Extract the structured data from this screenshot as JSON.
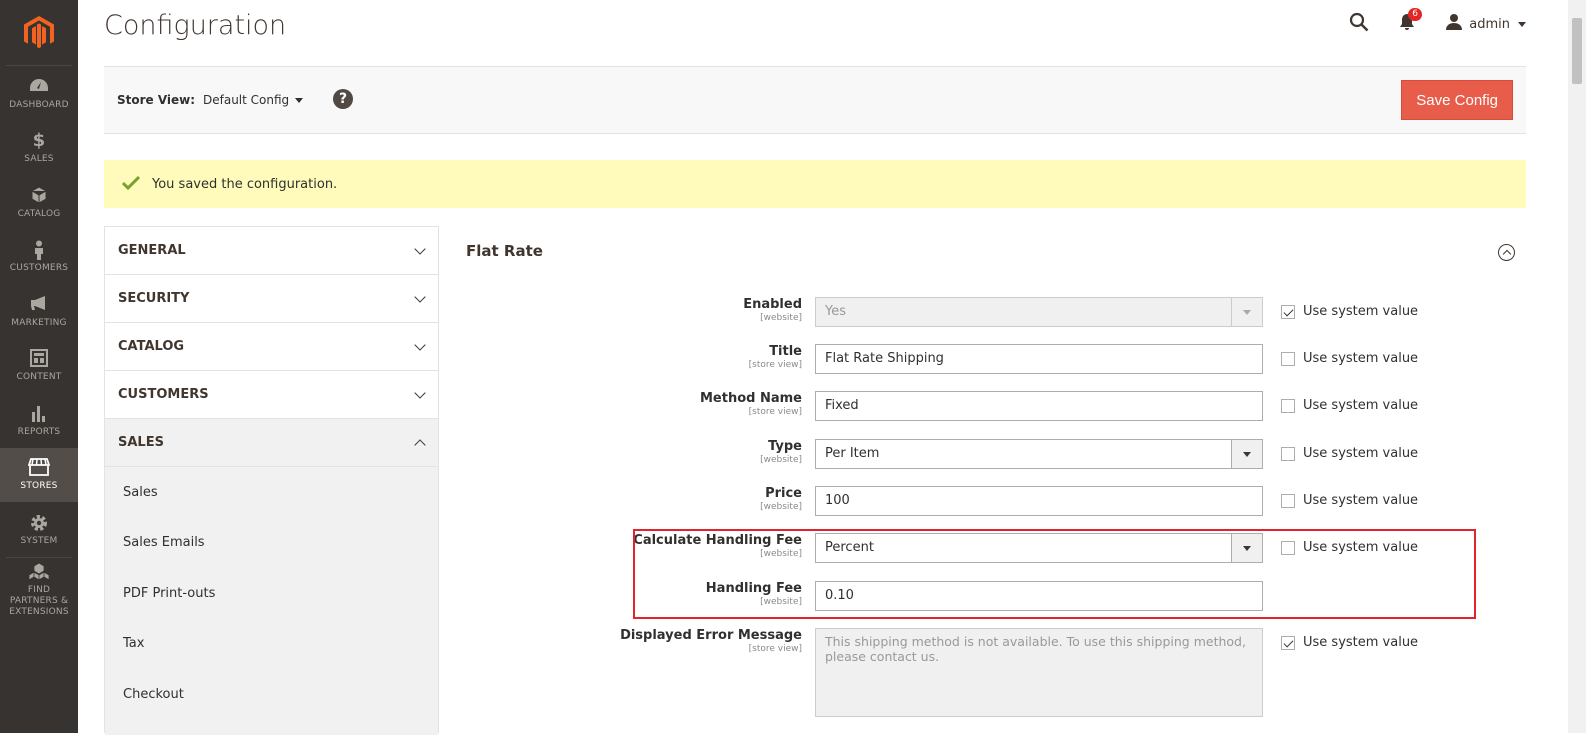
{
  "page": {
    "title": "Configuration"
  },
  "nav": {
    "items": [
      {
        "label": "DASHBOARD",
        "icon": "dashboard-icon"
      },
      {
        "label": "SALES",
        "icon": "dollar-icon"
      },
      {
        "label": "CATALOG",
        "icon": "box-icon"
      },
      {
        "label": "CUSTOMERS",
        "icon": "person-icon"
      },
      {
        "label": "MARKETING",
        "icon": "megaphone-icon"
      },
      {
        "label": "CONTENT",
        "icon": "layout-icon"
      },
      {
        "label": "REPORTS",
        "icon": "bar-chart-icon"
      },
      {
        "label": "STORES",
        "icon": "store-icon",
        "active": true
      },
      {
        "label": "SYSTEM",
        "icon": "gear-icon"
      },
      {
        "label": "FIND PARTNERS & EXTENSIONS",
        "icon": "cubes-icon"
      }
    ]
  },
  "header": {
    "notifications_count": "6",
    "user": "admin"
  },
  "store_view": {
    "label": "Store View:",
    "value": "Default Config",
    "help": "?"
  },
  "actions": {
    "save_label": "Save Config"
  },
  "message": {
    "text": "You saved the configuration."
  },
  "tabs": {
    "general": "GENERAL",
    "security": "SECURITY",
    "catalog": "CATALOG",
    "customers": "CUSTOMERS",
    "sales": "SALES",
    "sales_items": [
      "Sales",
      "Sales Emails",
      "PDF Print-outs",
      "Tax",
      "Checkout"
    ]
  },
  "section": {
    "title": "Flat Rate",
    "use_system_value": "Use system value",
    "fields": {
      "enabled": {
        "label": "Enabled",
        "scope": "[website]",
        "value": "Yes",
        "system": true
      },
      "title": {
        "label": "Title",
        "scope": "[store view]",
        "value": "Flat Rate Shipping",
        "system": false
      },
      "method_name": {
        "label": "Method Name",
        "scope": "[store view]",
        "value": "Fixed",
        "system": false
      },
      "type": {
        "label": "Type",
        "scope": "[website]",
        "value": "Per Item",
        "system": false
      },
      "price": {
        "label": "Price",
        "scope": "[website]",
        "value": "100",
        "system": false
      },
      "calc_fee": {
        "label": "Calculate Handling Fee",
        "scope": "[website]",
        "value": "Percent",
        "system": false
      },
      "handling_fee": {
        "label": "Handling Fee",
        "scope": "[website]",
        "value": "0.10"
      },
      "error_msg": {
        "label": "Displayed Error Message",
        "scope": "[store view]",
        "value": "This shipping method is not available. To use this shipping method, please contact us.",
        "system": true
      }
    }
  },
  "colors": {
    "accent": "#e85d4a",
    "nav_bg": "#373330",
    "message_bg": "#fffbbb",
    "highlight": "#e0242c"
  }
}
